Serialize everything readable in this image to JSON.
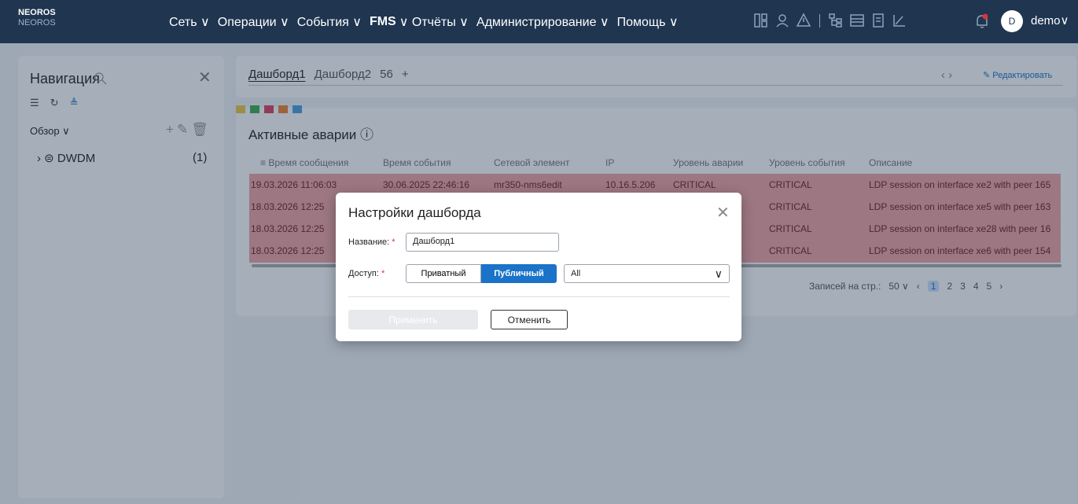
{
  "app": {
    "logo": "NEOROS",
    "logo_sub": "NEOROS"
  },
  "menu": [
    {
      "label": "Сеть ∨"
    },
    {
      "label": "Операции ∨"
    },
    {
      "label": "События ∨"
    },
    {
      "label": "FMS",
      "bold": true
    },
    {
      "label": "∨ Отчёты ∨"
    },
    {
      "label": "Администрирование ∨"
    },
    {
      "label": "Помощь ∨"
    }
  ],
  "user": {
    "avatar": "D",
    "name": "demo∨"
  },
  "sidebar": {
    "title": "Навигация",
    "overview": "Обзор ∨",
    "tree": [
      {
        "label": "› ⊜ DWDM",
        "count": "(1)"
      }
    ]
  },
  "tabs": {
    "items": [
      "Дашборд1",
      "Дашборд2",
      "56",
      "+"
    ],
    "arrows": "‹  ›",
    "edit": "Редактировать"
  },
  "widget": {
    "title": "Активные аварии ⓘ",
    "columns": [
      "≡ Время сообщения",
      "Время события",
      "Сетевой элемент",
      "IP",
      "Уровень аварии",
      "Уровень события",
      "Описание"
    ],
    "rows": [
      [
        "19.03.2026 11:06:03",
        "30.06.2025 22:46:16",
        "mr350-nms6edit",
        "10.16.5.206",
        "CRITICAL",
        "CRITICAL",
        "LDP session on interface xe2 with peer 165"
      ],
      [
        "18.03.2026 12:25",
        "",
        "",
        "",
        "",
        "CRITICAL",
        "LDP session on interface xe5 with peer 163"
      ],
      [
        "18.03.2026 12:25",
        "",
        "",
        "",
        "",
        "CRITICAL",
        "LDP session on interface xe28 with peer 16"
      ],
      [
        "18.03.2026 12:25",
        "",
        "",
        "",
        "",
        "CRITICAL",
        "LDP session on interface xe6 with peer 154"
      ]
    ],
    "pager": {
      "label": "Записей на стр.:",
      "size": "50 ∨",
      "pages": [
        "1",
        "2",
        "3",
        "4",
        "5"
      ]
    }
  },
  "modal": {
    "title": "Настройки дашборда",
    "name_label": "Название:",
    "name_value": "Дашборд1",
    "access_label": "Доступ:",
    "private": "Приватный",
    "public": "Публичный",
    "select_value": "All",
    "apply": "Применить",
    "cancel": "Отменить"
  },
  "colors": {
    "topbar": "#1f3550",
    "accent": "#1a73c8",
    "critical_row": "#f2a3a3"
  }
}
